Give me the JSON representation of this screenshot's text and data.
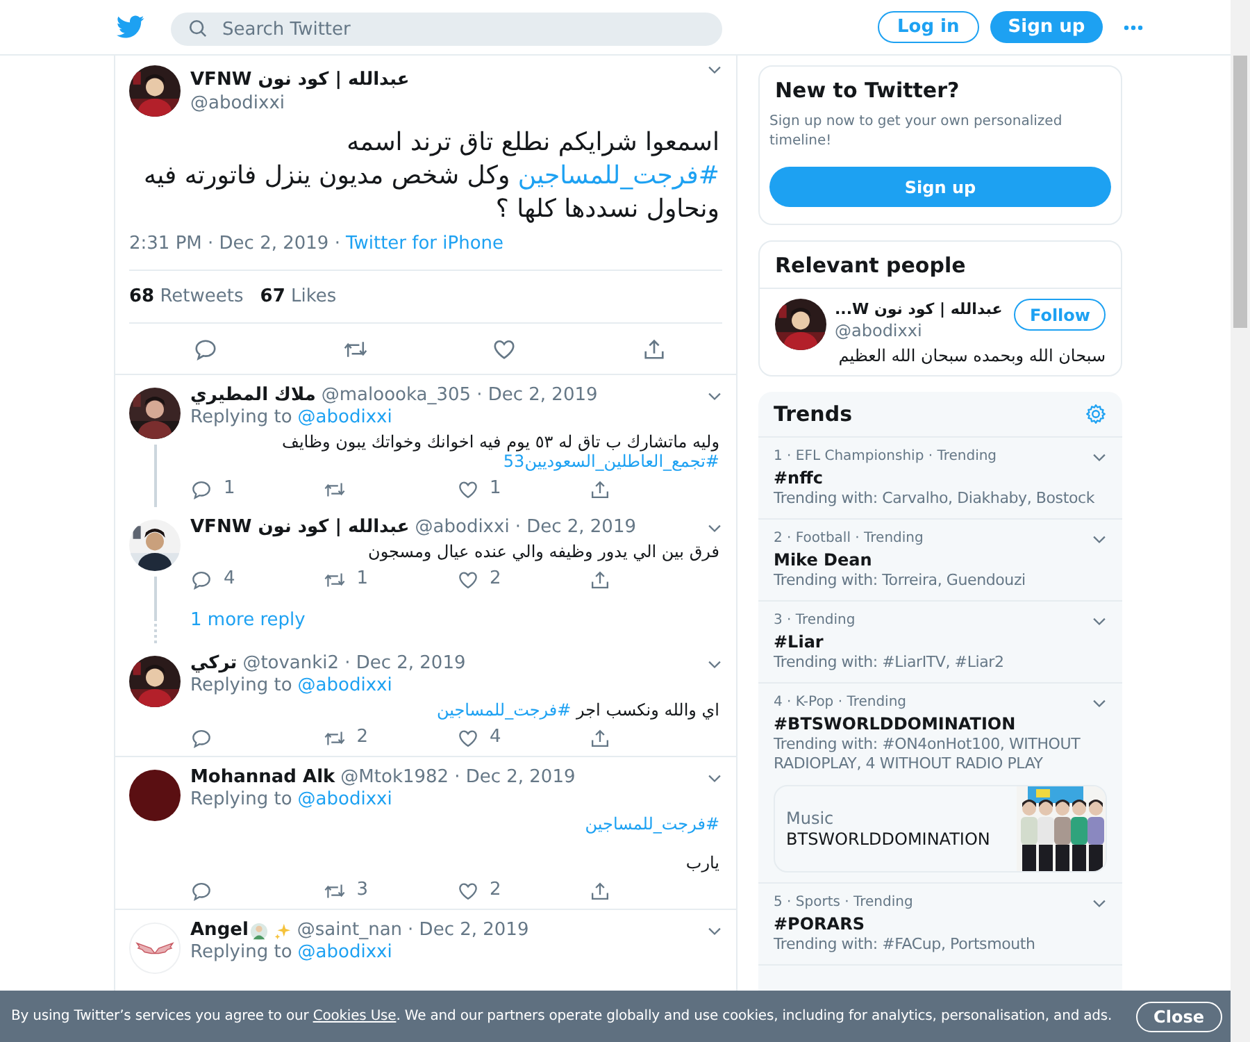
{
  "header": {
    "search": {
      "placeholder": "Search Twitter"
    },
    "login": "Log in",
    "signup": "Sign up"
  },
  "tweet": {
    "avatar": {
      "kind": "picture"
    },
    "name": "عبدالله | كود نون VFNW",
    "handle": "@abodixxi",
    "text": [
      {
        "kind": "text",
        "text": "اسمعوا شرايكم نطلع تاق ترند اسمه\n"
      },
      {
        "kind": "hashtag",
        "text": "#فرجت_للمساجين"
      },
      {
        "kind": "text",
        "text": " وكل شخص مديون ينزل فاتورته فيه ونحاول نسددها كلها ؟"
      }
    ],
    "time": "2:31 PM · Dec 2, 2019 ·",
    "source": "Twitter for iPhone",
    "retweets": "**68** Retweets",
    "likes": "**67** Likes"
  },
  "replies": [
    {
      "avatar": {
        "kind": "picture"
      },
      "name": "ملاك المطيري",
      "handle": "@maloooka_305",
      "date": "· Dec 2, 2019",
      "replying_label": "Replying to",
      "replying_handle": "@abodixxi",
      "text": [
        {
          "kind": "text",
          "text": "وليه ماتشارك ب تاق له ٥٣ يوم فيه اخوانك وخواتك يبون وظايف\n"
        },
        {
          "kind": "hashtag",
          "text": "#تجمع_العاطلين_السعوديين53"
        }
      ],
      "replies": "1",
      "likes": "1",
      "thread": true
    },
    {
      "avatar": {
        "kind": "picture"
      },
      "name": "عبدالله | كود نون VFNW",
      "handle": "@abodixxi",
      "date": "· Dec 2, 2019",
      "text": [
        {
          "kind": "text",
          "text": "فرق بين الي يدور وظيفه والي عنده عيال ومسجون"
        }
      ],
      "replies": "4",
      "retweets": "1",
      "likes": "2",
      "thread": true,
      "more": "1 more reply"
    },
    {
      "avatar": {
        "kind": "picture"
      },
      "name": "تركي",
      "handle": "@tovanki2",
      "date": "· Dec 2, 2019",
      "replying_label": "Replying to",
      "replying_handle": "@abodixxi",
      "text": [
        {
          "kind": "text",
          "text": "اي والله ونكسب اجر "
        },
        {
          "kind": "hashtag",
          "text": "#فرجت_للمساجين"
        }
      ],
      "retweets": "2",
      "likes": "4",
      "thread": false
    },
    {
      "avatar": {
        "kind": "plain"
      },
      "name": "Mohannad Alk",
      "handle": "@Mtok1982",
      "date": "· Dec 2, 2019",
      "replying_label": "Replying to",
      "replying_handle": "@abodixxi",
      "text": [
        {
          "kind": "hashtag",
          "text": "#فرجت_للمساجين"
        },
        {
          "kind": "text",
          "text": "\n\nيارب"
        }
      ],
      "retweets": "3",
      "likes": "2",
      "thread": false
    },
    {
      "avatar": {
        "kind": "logo"
      },
      "name": "Angel",
      "emoji": true,
      "handle": "@saint_nan",
      "date": "· Dec 2, 2019",
      "replying_label": "Replying to",
      "replying_handle": "@abodixxi",
      "thread": false
    }
  ],
  "new_to_twitter": {
    "title": "New to Twitter?",
    "text": "Sign up now to get your own personalized timeline!",
    "button": "Sign up"
  },
  "relevant_people": {
    "title": "Relevant people",
    "people": [
      {
        "name": "عبدالله | كود نون W...",
        "handle": "@abodixxi",
        "bio": "سبحان الله وبحمده سبحان الله العظيم",
        "button": "Follow"
      }
    ]
  },
  "trends": {
    "title": "Trends",
    "items": [
      {
        "meta": "1 · EFL Championship · Trending",
        "name": "#nffc",
        "trending_with": "Trending with: Carvalho, Diakhaby, Bostock"
      },
      {
        "meta": "2 · Football · Trending",
        "name": "Mike Dean",
        "trending_with": "Trending with: Torreira, Guendouzi"
      },
      {
        "meta": "3 · Trending",
        "name": "#Liar",
        "trending_with": "Trending with: #LiarITV, #Liar2"
      },
      {
        "meta": "4 · K-Pop · Trending",
        "name": "#BTSWORLDDOMINATION",
        "trending_with": "Trending with: #ON4onHot100, WITHOUT RADIOPLAY, 4 WITHOUT RADIO PLAY",
        "card": {
          "category": "Music",
          "title": "BTSWORLDDOMINATION"
        }
      },
      {
        "meta": "5 · Sports · Trending",
        "name": "#PORARS",
        "trending_with": "Trending with: #FACup, Portsmouth"
      }
    ]
  },
  "cookie_banner": {
    "text": [
      {
        "kind": "text",
        "text": "By using Twitter’s services you agree to our "
      },
      {
        "kind": "link",
        "text": "Cookies Use"
      },
      {
        "kind": "text",
        "text": ". We and our partners operate globally and use cookies, including for analytics, personalisation, and ads."
      }
    ],
    "button": "Close"
  }
}
